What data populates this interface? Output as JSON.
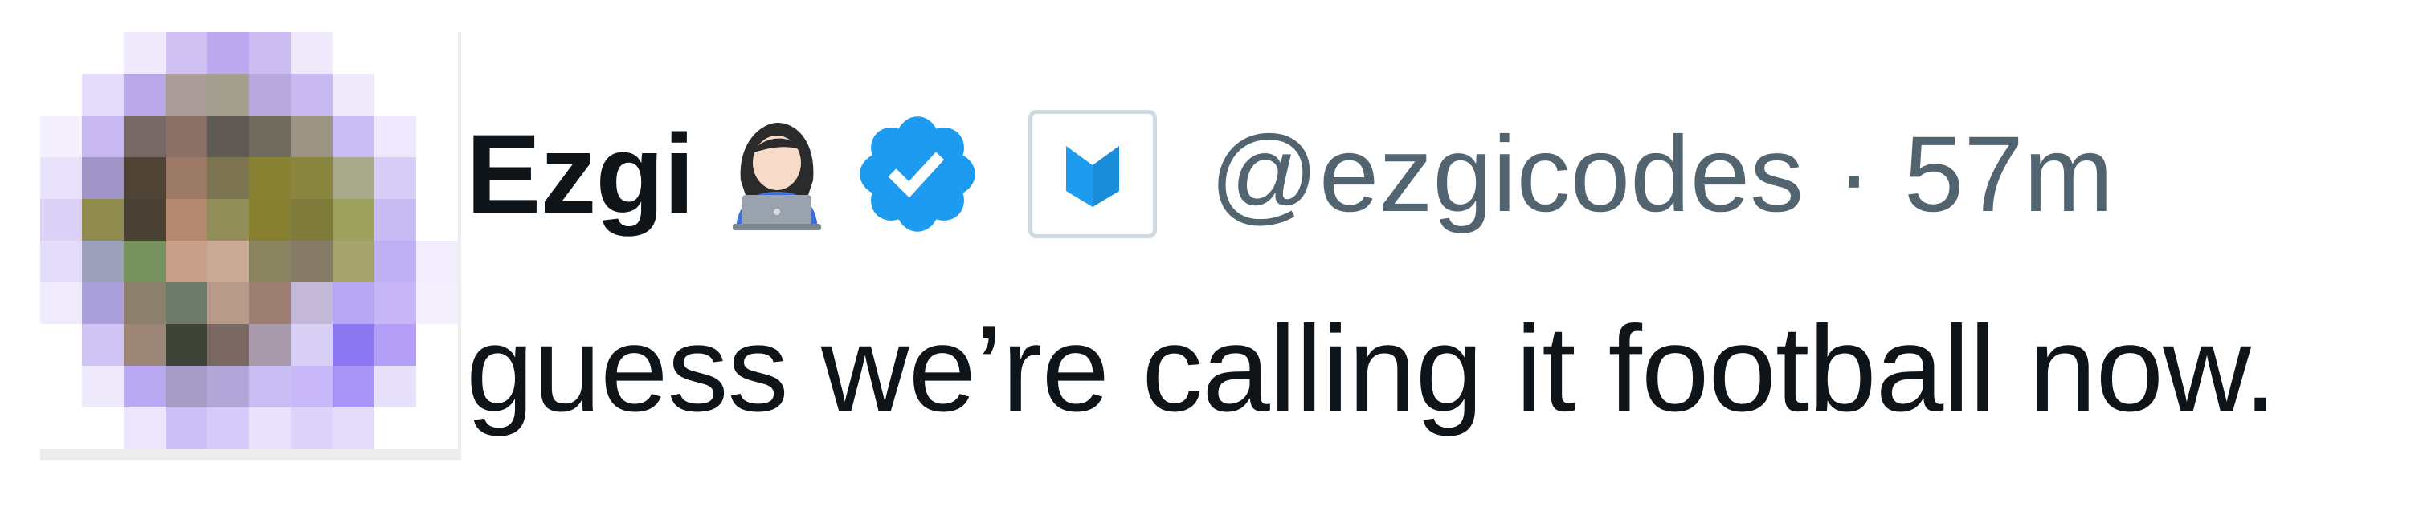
{
  "author": {
    "display_name": "Ezgi",
    "emoji_icon": "technologist-woman-laptop-emoji",
    "verified_icon": "verified-badge-icon",
    "affiliate_icon": "affiliate-badge-icon",
    "handle": "@ezgicodes",
    "separator": "·",
    "timestamp": "57m"
  },
  "tweet": {
    "text": "guess we’re calling it football now."
  },
  "colors": {
    "text_primary": "#0f1419",
    "text_secondary": "#536471",
    "verified_blue": "#1d9bf0"
  }
}
